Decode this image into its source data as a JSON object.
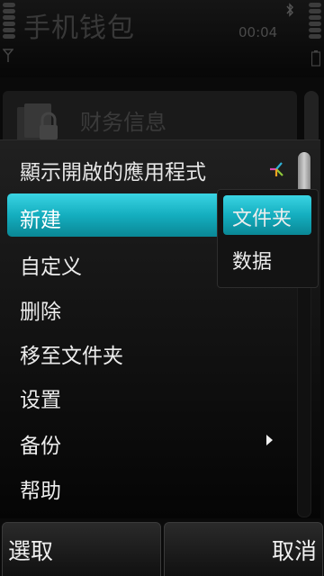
{
  "status_bar": {
    "app_title": "手机钱包",
    "time": "00:04",
    "signal_icon": "signal-strength-icon",
    "battery_icon": "battery-icon",
    "bluetooth_icon": "bluetooth-icon"
  },
  "background": {
    "list_item_label": "财务信息",
    "list_item_icon": "locked-folder-icon"
  },
  "menu": {
    "header": "顯示開啟的應用程式",
    "header_icon": "task-switch-icon",
    "items": [
      {
        "label": "新建"
      },
      {
        "label": "自定义"
      },
      {
        "label": "删除"
      },
      {
        "label": "移至文件夹"
      },
      {
        "label": "设置"
      },
      {
        "label": "备份"
      },
      {
        "label": "帮助"
      }
    ],
    "submenu": {
      "items": [
        {
          "label": "文件夹"
        },
        {
          "label": "数据"
        }
      ]
    }
  },
  "softkeys": {
    "left": "選取",
    "right": "取消"
  },
  "colors": {
    "highlight": "#14aebf",
    "background": "#0a0a0a",
    "text": "#ececec"
  }
}
